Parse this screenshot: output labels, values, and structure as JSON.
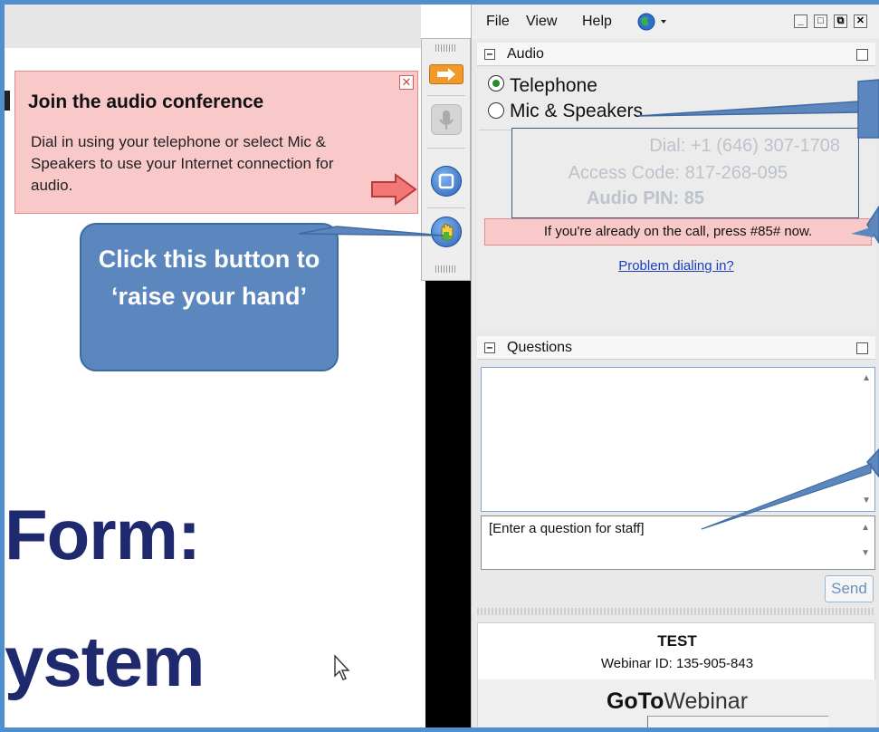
{
  "notification": {
    "title": "Join the audio conference",
    "body": "Dial in using your telephone or select Mic & Speakers to use your Internet connection for audio."
  },
  "callout": {
    "text": "Click this button to ‘raise your hand’"
  },
  "slide": {
    "line1": "Form:",
    "line2": "ystem"
  },
  "menu": {
    "file": "File",
    "view": "View",
    "help": "Help"
  },
  "audio": {
    "title": "Audio",
    "option_telephone": "Telephone",
    "option_mic": "Mic & Speakers",
    "dial": "Dial: +1 (646) 307-1708",
    "access_code": "Access Code: 817-268-095",
    "audio_pin": "Audio PIN: 85",
    "already": "If you're already on the call, press #85# now.",
    "problem": "Problem dialing in?"
  },
  "questions": {
    "title": "Questions",
    "input_placeholder": "[Enter a question for staff]",
    "send": "Send"
  },
  "footer": {
    "title": "TEST",
    "webinar_id": "Webinar ID: 135-905-843",
    "brand_bold": "GoTo",
    "brand_rest": "Webinar"
  },
  "colors": {
    "frame": "#4f8fcf",
    "callout": "#5b87be",
    "notify_bg": "#f9c9c9",
    "slide_text": "#1f2a6e"
  }
}
